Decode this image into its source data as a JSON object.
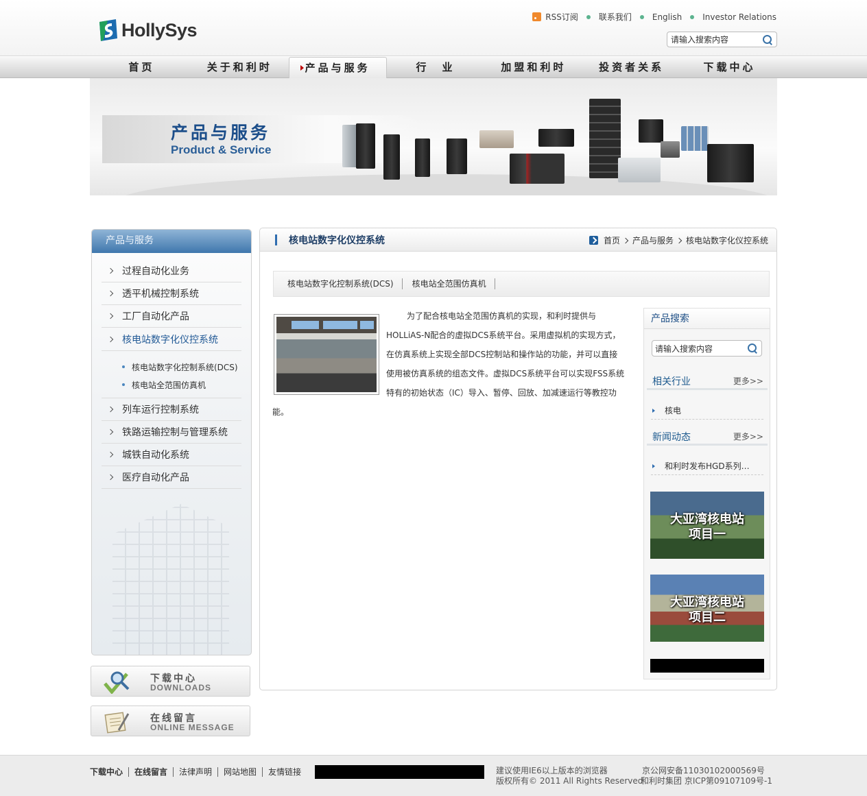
{
  "header": {
    "logo_text": "HollySys",
    "top_links": [
      "RSS订阅",
      "联系我们",
      "English",
      "Investor Relations"
    ],
    "search_placeholder": "请输入搜索内容"
  },
  "nav": {
    "items": [
      "首页",
      "关于和利时",
      "产品与服务",
      "行　业",
      "加盟和利时",
      "投资者关系",
      "下载中心"
    ],
    "active_index": 2
  },
  "banner": {
    "title_cn": "产品与服务",
    "title_en": "Product & Service"
  },
  "sidebar": {
    "heading": "产品与服务",
    "items": [
      "过程自动化业务",
      "透平机械控制系统",
      "工厂自动化产品",
      "核电站数字化仪控系统",
      "列车运行控制系统",
      "铁路运输控制与管理系统",
      "城铁自动化系统",
      "医疗自动化产品"
    ],
    "active_index": 3,
    "sub_items": [
      "核电站数字化控制系统(DCS)",
      "核电站全范围仿真机"
    ]
  },
  "quick_links": [
    {
      "cn": "下载中心",
      "en": "DOWNLOADS"
    },
    {
      "cn": "在线留言",
      "en": "ONLINE MESSAGE"
    }
  ],
  "main": {
    "title": "核电站数字化仪控系统",
    "breadcrumb": [
      "首页",
      "产品与服务",
      "核电站数字化仪控系统"
    ],
    "tabs": [
      "核电站数字化控制系统(DCS)",
      "核电站全范围仿真机"
    ],
    "article": "为了配合核电站全范围仿真机的实现，和利时提供与HOLLiAS-N配合的虚拟DCS系统平台。采用虚拟机的实现方式，在仿真系统上实现全部DCS控制站和操作站的功能，并可以直接使用被仿真系统的组态文件。虚拟DCS系统平台可以实现FSS系统特有的初始状态（IC）导入、暂停、回放、加减速运行等教控功能。"
  },
  "right": {
    "search_title": "产品搜索",
    "search_placeholder": "请输入搜索内容",
    "related_title": "相关行业",
    "related_more": "更多>>",
    "related_items": [
      "核电"
    ],
    "news_title": "新闻动态",
    "news_more": "更多>>",
    "news_items": [
      "和利时发布HGD系列…"
    ],
    "projects": [
      "大亚湾核电站\n项目一",
      "大亚湾核电站\n项目二"
    ]
  },
  "footer": {
    "links": [
      "下载中心",
      "在线留言",
      "法律声明",
      "网站地图",
      "友情链接"
    ],
    "browser_note": "建议使用IE6以上版本的浏览器",
    "copyright": "版权所有© 2011 All Rights Reserved",
    "police_record": "京公网安备11030102000569号",
    "icp": "和利时集团  京ICP第09107109号-1"
  }
}
